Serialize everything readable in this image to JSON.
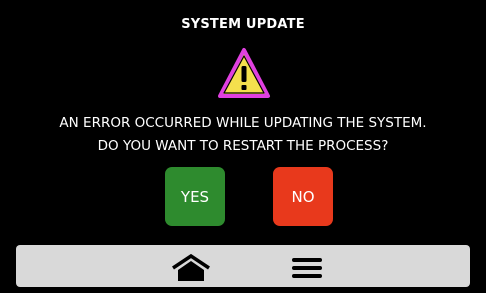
{
  "dialog": {
    "title": "SYSTEM UPDATE",
    "icon": "warning-icon",
    "message_line1": "AN ERROR OCCURRED WHILE UPDATING THE SYSTEM.",
    "message_line2": "DO YOU WANT TO RESTART THE PROCESS?",
    "yes_label": "YES",
    "no_label": "NO"
  },
  "navbar": {
    "items": [
      {
        "icon": "home-icon"
      },
      {
        "icon": "menu-icon"
      }
    ]
  },
  "colors": {
    "background": "#000000",
    "yes_button": "#2e8b2e",
    "no_button": "#e8391c",
    "warning_fill": "#f4e04d",
    "warning_outline": "#e040e0",
    "navbar": "#d9d9d9"
  }
}
